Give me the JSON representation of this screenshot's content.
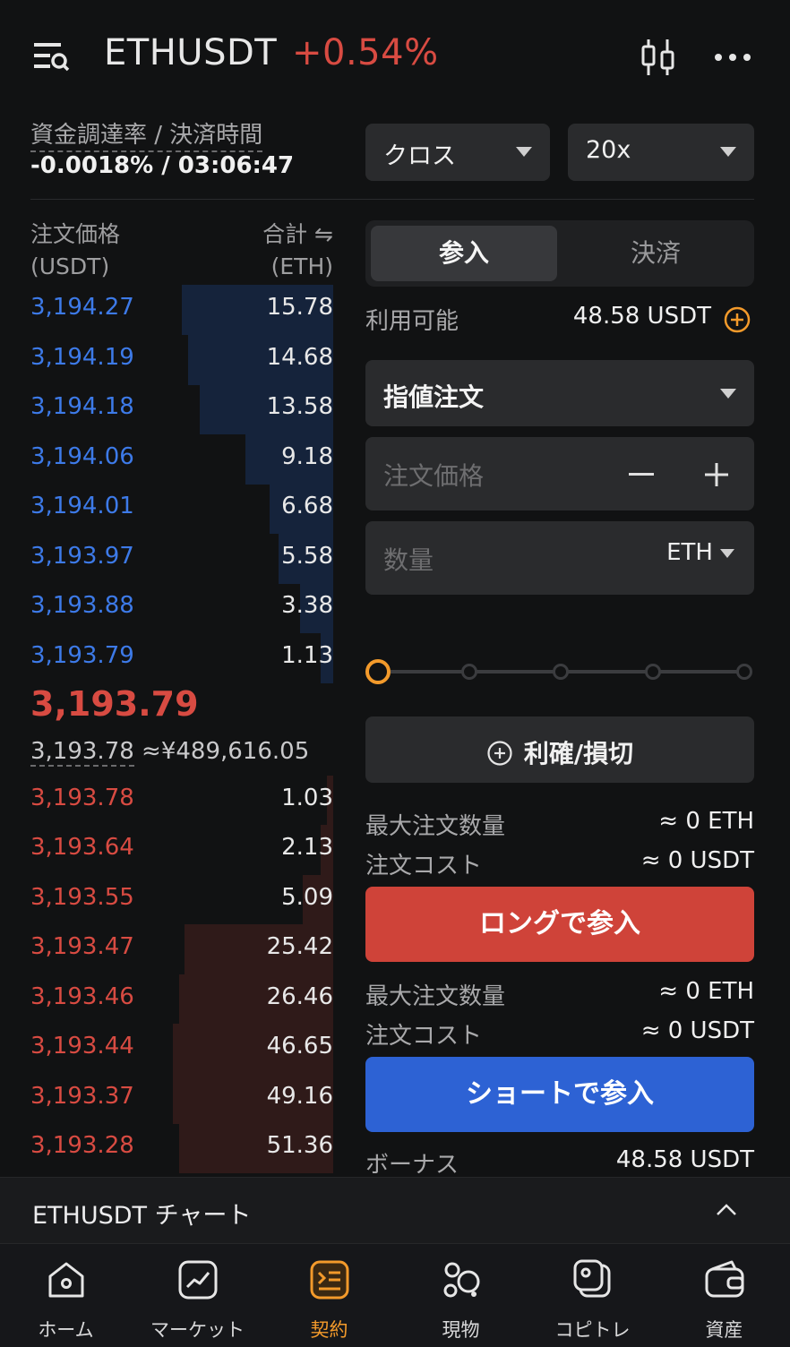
{
  "header": {
    "pair": "ETHUSDT",
    "change": "+0.54%"
  },
  "funding": {
    "label": "資金調達率 / 決済時間",
    "value": "-0.0018% / 03:06:47"
  },
  "margin_mode": "クロス",
  "leverage": "20x",
  "orderbook": {
    "price_header": "注文価格",
    "price_unit": "(USDT)",
    "total_header": "合計 ⇋",
    "total_unit": "(ETH)",
    "asks": [
      {
        "price": "3,194.27",
        "qty": "15.78",
        "depth": 0.5
      },
      {
        "price": "3,194.19",
        "qty": "14.68",
        "depth": 0.48
      },
      {
        "price": "3,194.18",
        "qty": "13.58",
        "depth": 0.44
      },
      {
        "price": "3,194.06",
        "qty": "9.18",
        "depth": 0.29
      },
      {
        "price": "3,194.01",
        "qty": "6.68",
        "depth": 0.21
      },
      {
        "price": "3,193.97",
        "qty": "5.58",
        "depth": 0.18
      },
      {
        "price": "3,193.88",
        "qty": "3.38",
        "depth": 0.11
      },
      {
        "price": "3,193.79",
        "qty": "1.13",
        "depth": 0.04
      }
    ],
    "last_price": "3,193.79",
    "mark_price": "3,193.78",
    "fiat_price": "≈¥489,616.05",
    "bids": [
      {
        "price": "3,193.78",
        "qty": "1.03",
        "depth": 0.02
      },
      {
        "price": "3,193.64",
        "qty": "2.13",
        "depth": 0.04
      },
      {
        "price": "3,193.55",
        "qty": "5.09",
        "depth": 0.1
      },
      {
        "price": "3,193.47",
        "qty": "25.42",
        "depth": 0.49
      },
      {
        "price": "3,193.46",
        "qty": "26.46",
        "depth": 0.51
      },
      {
        "price": "3,193.44",
        "qty": "46.65",
        "depth": 0.53
      },
      {
        "price": "3,193.37",
        "qty": "49.16",
        "depth": 0.53
      },
      {
        "price": "3,193.28",
        "qty": "51.36",
        "depth": 0.51
      }
    ]
  },
  "form": {
    "tab_open": "参入",
    "tab_close": "決済",
    "available_label": "利用可能",
    "available_value": "48.58 USDT",
    "order_type": "指値注文",
    "price_placeholder": "注文価格",
    "qty_placeholder": "数量",
    "qty_unit": "ETH",
    "slider_percent": 0,
    "tpsl_label": "利確/損切",
    "long": {
      "max_label": "最大注文数量",
      "max_value": "≈ 0 ETH",
      "cost_label": "注文コスト",
      "cost_value": "≈ 0 USDT",
      "button": "ロングで参入"
    },
    "short": {
      "max_label": "最大注文数量",
      "max_value": "≈ 0 ETH",
      "cost_label": "注文コスト",
      "cost_value": "≈ 0 USDT",
      "button": "ショートで参入"
    },
    "bonus_label": "ボーナス",
    "bonus_value": "48.58 USDT"
  },
  "chart_strip": {
    "label": "ETHUSDT チャート"
  },
  "nav": [
    {
      "label": "ホーム",
      "icon": "home-icon"
    },
    {
      "label": "マーケット",
      "icon": "market-icon"
    },
    {
      "label": "契約",
      "icon": "futures-icon",
      "active": true
    },
    {
      "label": "現物",
      "icon": "spot-icon"
    },
    {
      "label": "コピトレ",
      "icon": "copy-trade-icon"
    },
    {
      "label": "資産",
      "icon": "wallet-icon"
    }
  ],
  "colors": {
    "accent": "#f39a2b",
    "up": "#d84b42",
    "down": "#3d7ae8",
    "long": "#cf4339",
    "short": "#2d62d4"
  }
}
